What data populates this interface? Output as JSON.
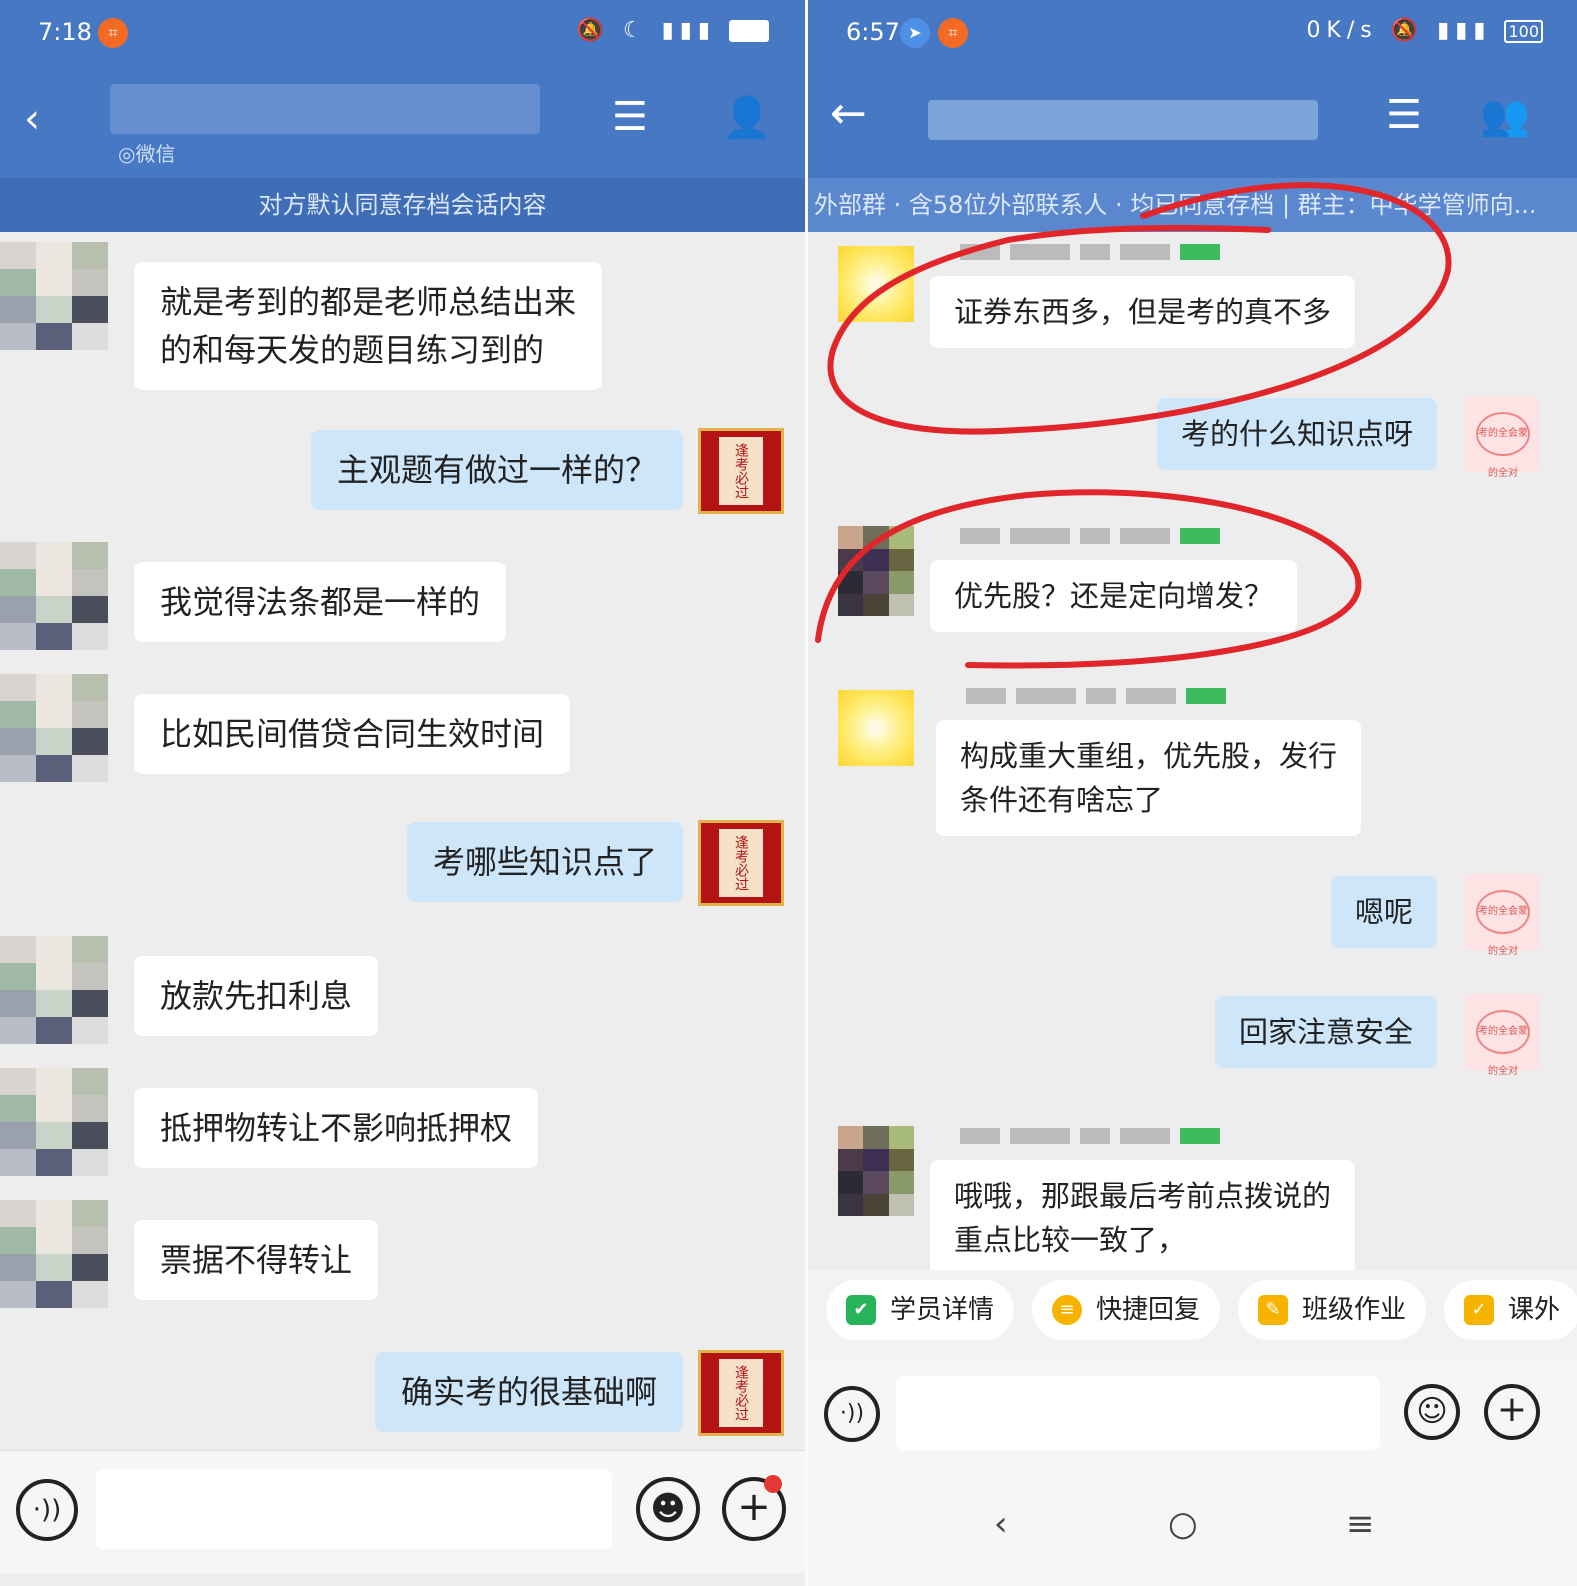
{
  "left": {
    "status": {
      "time": "7:18",
      "noti_icon": "crop-notification-icon",
      "sys_icons": "mute-icon moon-icon 4G-signal-icon battery-icon"
    },
    "header": {
      "subtitle": "◎微信",
      "notice": "对方默认同意存档会话内容"
    },
    "messages": [
      {
        "side": "in",
        "text": "就是考到的都是老师总结出来\n的和每天发的题目练习到的"
      },
      {
        "side": "out",
        "text": "主观题有做过一样的？"
      },
      {
        "side": "in",
        "text": "我觉得法条都是一样的"
      },
      {
        "side": "in",
        "text": "比如民间借贷合同生效时间"
      },
      {
        "side": "out",
        "text": "考哪些知识点了"
      },
      {
        "side": "in",
        "text": "放款先扣利息"
      },
      {
        "side": "in",
        "text": "抵押物转让不影响抵押权"
      },
      {
        "side": "in",
        "text": "票据不得转让"
      },
      {
        "side": "out",
        "text": "确实考的很基础啊"
      }
    ],
    "sticker_text": "逢考必过"
  },
  "right": {
    "status": {
      "time": "6:57",
      "speed": "0K/s",
      "battery": "100"
    },
    "header": {
      "notice": "外部群 · 含58位外部联系人 · 均已同意存档 | 群主：中华学管师向..."
    },
    "messages": [
      {
        "side": "in",
        "text": "证券东西多，但是考的真不多"
      },
      {
        "side": "out",
        "text": "考的什么知识点呀"
      },
      {
        "side": "in",
        "text": "优先股？还是定向增发？"
      },
      {
        "side": "in",
        "text": "构成重大重组，优先股，发行\n条件还有啥忘了"
      },
      {
        "side": "out",
        "text": "嗯呢"
      },
      {
        "side": "out",
        "text": "回家注意安全"
      },
      {
        "side": "in",
        "text": "哦哦，那跟最后考前点拨说的\n重点比较一致了，"
      }
    ],
    "sticker_text": "考的全会蒙的全对",
    "quick_actions": [
      "学员详情",
      "快捷回复",
      "班级作业",
      "课外"
    ],
    "annotation_color": "#e0262a"
  },
  "colors": {
    "header": "#4778c3",
    "bubble_out": "#cde6fa",
    "bubble_in": "#ffffff",
    "bg": "#ededed"
  }
}
